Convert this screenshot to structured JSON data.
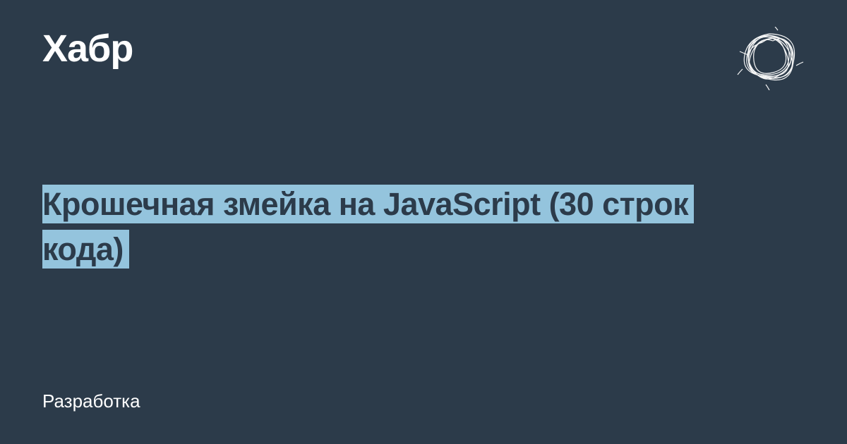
{
  "header": {
    "logo": "Хабр"
  },
  "article": {
    "title": "Крошечная змейка на JavaScript (30 строк кода)",
    "category": "Разработка"
  },
  "colors": {
    "background": "#2c3b4a",
    "highlight": "#94c4dd",
    "text_light": "#ffffff"
  }
}
